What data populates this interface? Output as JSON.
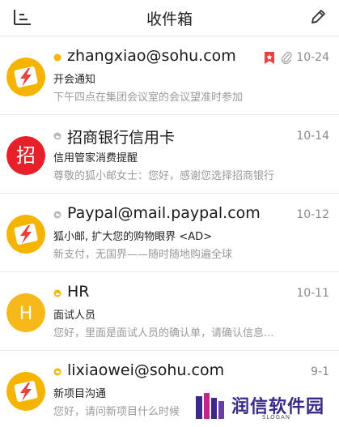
{
  "header": {
    "title": "收件箱",
    "menu_icon": "menu-icon",
    "compose_icon": "compose-icon"
  },
  "colors": {
    "unread_dot": "#f5b800",
    "flag": "#e8423f",
    "avatar_orange": "#f4b400",
    "avatar_red": "#e62129",
    "avatar_h": "#f7b81b",
    "brand": "#3b2a8a"
  },
  "mails": [
    {
      "sender": "zhangxiao@sohu.com",
      "subject": "开会通知",
      "preview": "下午四点在集团会议室的会议望准时参加",
      "date": "10-24",
      "status": "unread-dot",
      "avatar": "lightning-avatar",
      "flagged": true,
      "has_attachment": true
    },
    {
      "sender": "招商银行信用卡",
      "subject": "信用管家消费提醒",
      "preview": "尊敬的狐小邮女士：您好，感谢您选择招商银行",
      "date": "10-14",
      "status": "forwarded-gray",
      "avatar": "zhao-avatar",
      "avatar_text": "招",
      "flagged": false,
      "has_attachment": false
    },
    {
      "sender": "Paypal@mail.paypal.com",
      "subject": "狐小邮, 扩大您的购物眼界 <AD>",
      "preview": "新支付，无国界——随时随地购遍全球",
      "date": "10-12",
      "status": "replied-gray",
      "avatar": "lightning-avatar",
      "flagged": false,
      "has_attachment": false
    },
    {
      "sender": "HR",
      "subject": "面试人员",
      "preview": "您好，里面是面试人员的确认单，请确认信息...",
      "date": "10-11",
      "status": "forwarded-orange",
      "avatar": "h-avatar",
      "avatar_text": "H",
      "flagged": false,
      "has_attachment": false
    },
    {
      "sender": "lixiaowei@sohu.com",
      "subject": "新项目沟通",
      "preview": "您好，请问新项目什么时候",
      "date": "9-1",
      "status": "replied-orange",
      "avatar": "lightning-avatar",
      "flagged": false,
      "has_attachment": false
    }
  ],
  "watermark": {
    "brand": "润信软件园",
    "slogan": "SLOGAN"
  }
}
